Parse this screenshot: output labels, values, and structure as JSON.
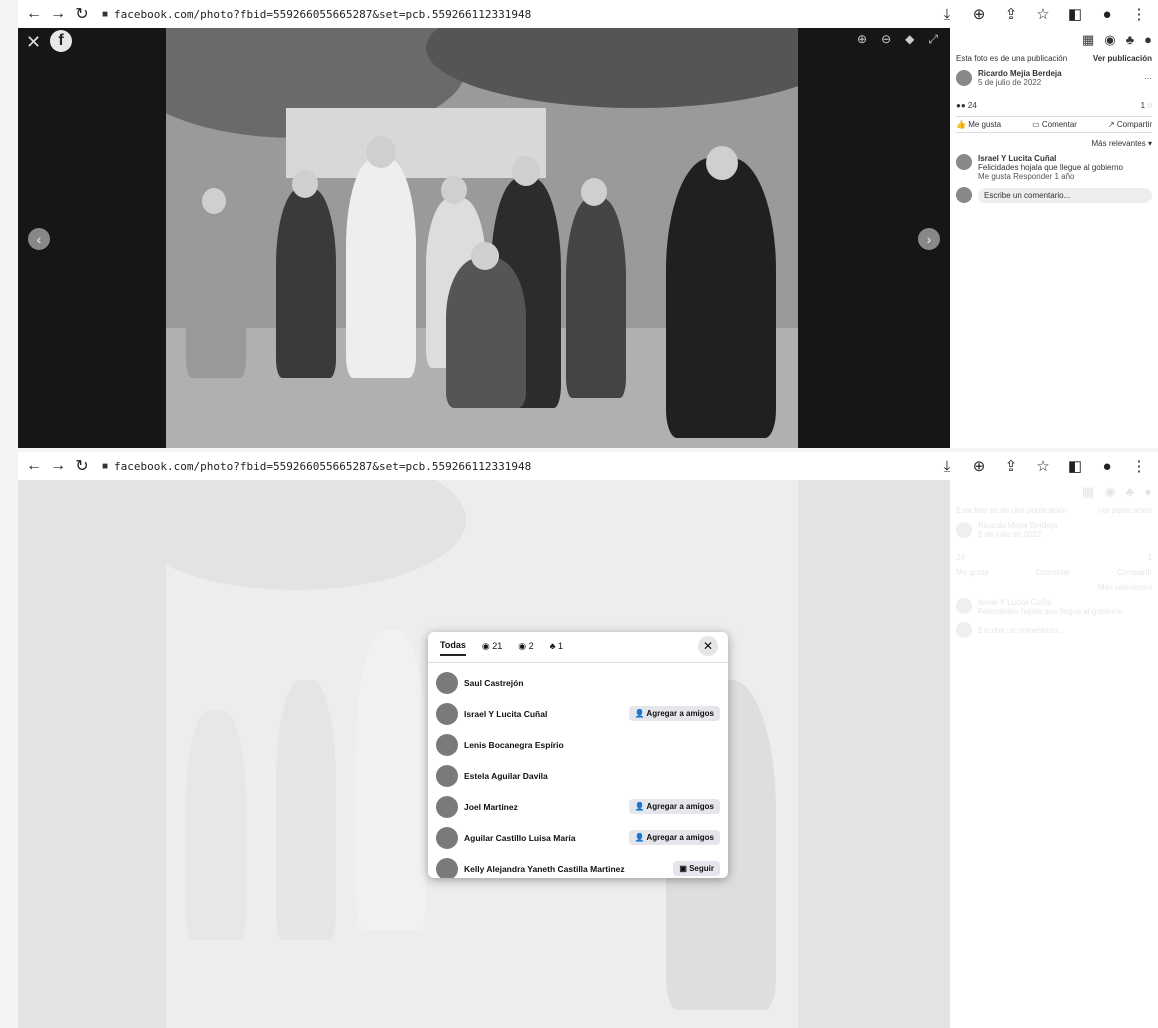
{
  "browser": {
    "url_top": "facebook.com/photo?fbid=559266055665287&set=pcb.559266112331948",
    "url_bottom": "facebook.com/photo?fbid=559266055665287&set=pcb.559266112331948"
  },
  "sidebar": {
    "post_notice": "Esta foto es de una publicación",
    "view_post": "Ver publicación",
    "author": "Ricardo Mejía Berdeja",
    "date": "5 de julio de 2022",
    "reaction_count": "24",
    "comment_count": "1",
    "like": "Me gusta",
    "comment": "Comentar",
    "share": "Compartir",
    "relevance": "Más relevantes",
    "commenter": "Israel Y Lucita Cuñal",
    "comment_text": "Felicidades hojala que llegue al gobierno",
    "comment_actions": "Me gusta  Responder  1 año",
    "write_comment": "Escribe un comentario..."
  },
  "dialog": {
    "tabs": [
      {
        "label": "Todas"
      },
      {
        "label": "21"
      },
      {
        "label": "2"
      },
      {
        "label": "1"
      }
    ],
    "people": [
      {
        "name": "Saul Castrejón",
        "action": ""
      },
      {
        "name": "Israel Y Lucita Cuñal",
        "action": "Agregar a amigos"
      },
      {
        "name": "Lenis Bocanegra Espírio",
        "action": ""
      },
      {
        "name": "Estela Aguilar Davila",
        "action": ""
      },
      {
        "name": "Joel Martinez",
        "action": "Agregar a amigos"
      },
      {
        "name": "Aguilar Castillo Luisa María",
        "action": "Agregar a amigos"
      },
      {
        "name": "Kelly Alejandra Yaneth Castilla Martinez",
        "action": "Seguir"
      }
    ]
  },
  "colors": {
    "viewer_bg": "#161616",
    "overlay": "rgba(255,255,255,0.72)",
    "button_bg": "#e4e6eb"
  },
  "icons": {
    "back": "back-arrow-icon",
    "forward": "forward-arrow-icon",
    "reload": "reload-icon",
    "lock": "lock-icon",
    "close": "close-icon",
    "facebook": "facebook-logo-icon"
  }
}
